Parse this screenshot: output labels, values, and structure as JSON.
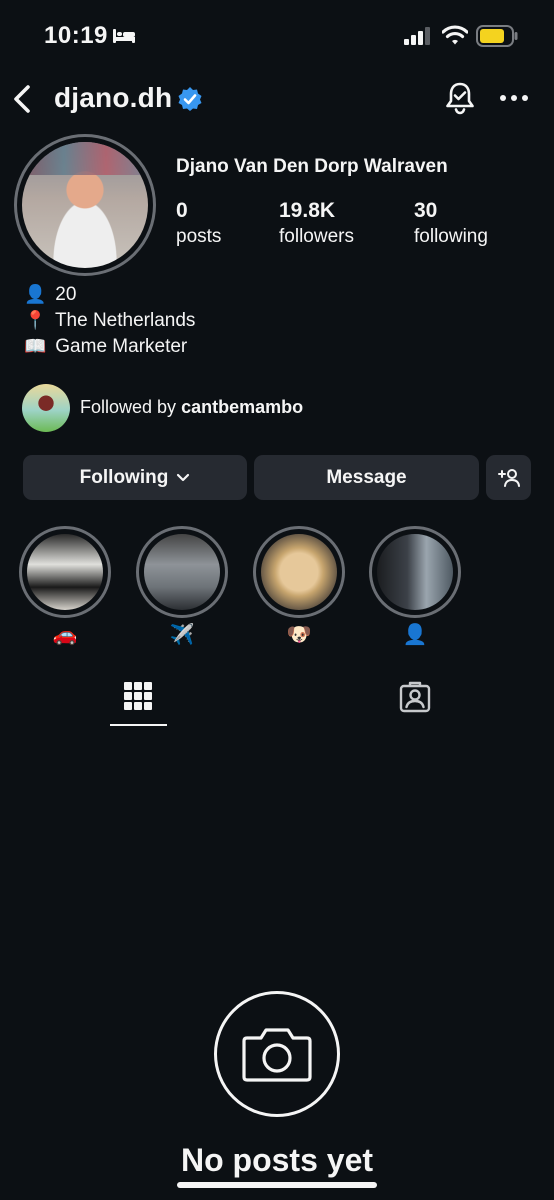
{
  "status_bar": {
    "time": "10:19",
    "icons": [
      "bed-icon",
      "signal-icon",
      "wifi-icon",
      "battery-icon"
    ],
    "battery_color": "#f4d31f"
  },
  "header": {
    "username": "djano.dh",
    "verified": true,
    "icons": [
      "back-icon",
      "verified-icon",
      "notification-bell-icon",
      "more-icon"
    ],
    "accent_color": "#3897f0"
  },
  "profile": {
    "full_name": "Djano Van Den Dorp Walraven",
    "stats": [
      {
        "value": "0",
        "label": "posts"
      },
      {
        "value": "19.8K",
        "label": "followers"
      },
      {
        "value": "30",
        "label": "following"
      }
    ],
    "bio": [
      {
        "emoji": "👤",
        "text": "20"
      },
      {
        "emoji": "📍",
        "text": "The Netherlands"
      },
      {
        "emoji": "📖",
        "text": "Game Marketer"
      }
    ],
    "followed_by_prefix": "Followed by ",
    "followed_by_user": "cantbemambo"
  },
  "actions": {
    "following_label": "Following",
    "message_label": "Message",
    "add_user_icon": "add-user-icon"
  },
  "highlights": [
    {
      "label": "🚗"
    },
    {
      "label": "✈️"
    },
    {
      "label": "🐶"
    },
    {
      "label": "👤"
    }
  ],
  "tabs": [
    {
      "icon": "grid-icon",
      "active": true
    },
    {
      "icon": "tagged-icon",
      "active": false
    }
  ],
  "empty_state": {
    "icon": "camera-icon",
    "text": "No posts yet"
  },
  "colors": {
    "background": "#0c1014",
    "button": "#262a31",
    "text": "#f5f5f5"
  }
}
